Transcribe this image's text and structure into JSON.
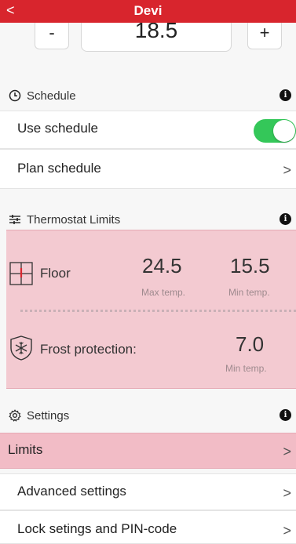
{
  "header": {
    "back_icon": "chevron-left-icon",
    "back_glyph": "<",
    "title": "Devi"
  },
  "setpoint": {
    "minus_label": "-",
    "value": "18.5",
    "plus_label": "+"
  },
  "schedule": {
    "icon": "clock-icon",
    "title": "Schedule",
    "info_glyph": "i",
    "use_schedule_label": "Use schedule",
    "use_schedule_on": true,
    "plan_schedule_label": "Plan schedule"
  },
  "thermostat_limits": {
    "icon": "sliders-icon",
    "title": "Thermostat Limits",
    "info_glyph": "i",
    "floor": {
      "icon": "floor-sensor-icon",
      "label": "Floor",
      "max_value": "24.5",
      "max_caption": "Max temp.",
      "min_value": "15.5",
      "min_caption": "Min temp."
    },
    "frost": {
      "icon": "snowflake-shield-icon",
      "label": "Frost protection:",
      "min_value": "7.0",
      "min_caption": "Min temp."
    }
  },
  "settings": {
    "icon": "gear-icon",
    "title": "Settings",
    "info_glyph": "i",
    "items": [
      {
        "label": "Limits",
        "highlighted": true
      },
      {
        "label": "Advanced settings",
        "highlighted": false
      },
      {
        "label": "Lock setings and PIN-code",
        "highlighted": false
      }
    ],
    "chevron_glyph": ">"
  },
  "colors": {
    "header_bg": "#d8252d",
    "toggle_on": "#34c759",
    "limits_panel_bg": "#f3cad1",
    "selected_row_bg": "#f2bcc6"
  }
}
